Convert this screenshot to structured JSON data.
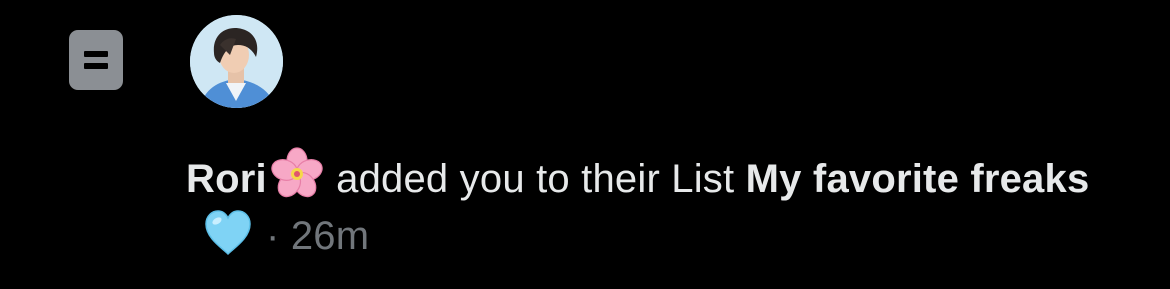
{
  "notification": {
    "icon": "list-icon",
    "avatar": "user-avatar",
    "user_name": "Rori",
    "name_emoji": "cherry-blossom-emoji",
    "action_text": " added you to their List ",
    "list_name": "My favorite freaks",
    "list_emoji": "light-blue-heart-emoji",
    "separator": "·",
    "timestamp": "26m"
  },
  "colors": {
    "background": "#000000",
    "primary_text": "#e7e9ea",
    "secondary_text": "#71767b",
    "list_icon": "#8b8f94"
  }
}
